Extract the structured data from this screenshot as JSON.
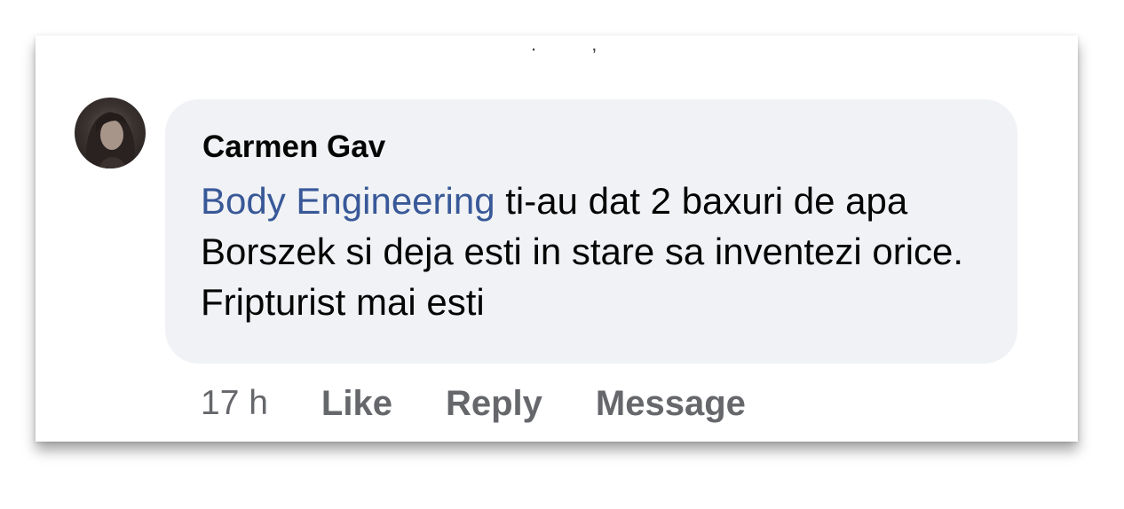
{
  "comment": {
    "author": "Carmen Gav",
    "mention": "Body Engineering",
    "text": " ti-au dat 2 baxuri de apa Borszek si deja esti in stare sa inventezi orice. Fripturist mai esti",
    "timestamp": "17 h",
    "actions": {
      "like": "Like",
      "reply": "Reply",
      "message": "Message"
    }
  },
  "colors": {
    "bubble": "#f0f2f5",
    "mention": "#385898",
    "secondary_text": "#65676b",
    "primary_text": "#050505"
  },
  "icons": {
    "avatar": "user-avatar-photo"
  }
}
